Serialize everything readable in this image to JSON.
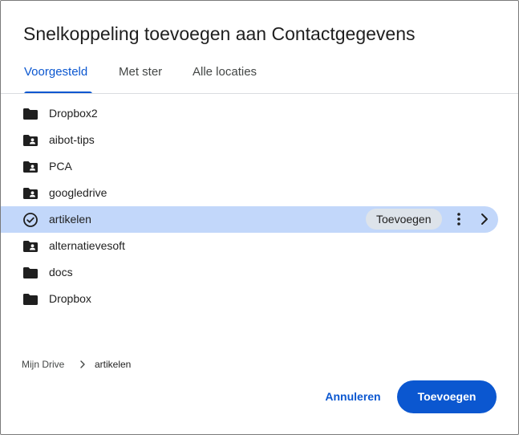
{
  "dialog": {
    "title": "Snelkoppeling toevoegen aan Contactgegevens"
  },
  "tabs": [
    {
      "label": "Voorgesteld",
      "active": true
    },
    {
      "label": "Met ster",
      "active": false
    },
    {
      "label": "Alle locaties",
      "active": false
    }
  ],
  "folders": [
    {
      "label": "Dropbox2",
      "icon": "folder-icon"
    },
    {
      "label": "aibot-tips",
      "icon": "shared-folder-icon"
    },
    {
      "label": "PCA",
      "icon": "shared-folder-icon"
    },
    {
      "label": "googledrive",
      "icon": "shared-folder-icon"
    },
    {
      "label": "artikelen",
      "icon": "check-circle-icon",
      "selected": true,
      "action_label": "Toevoegen"
    },
    {
      "label": "alternatievesoft",
      "icon": "shared-folder-icon"
    },
    {
      "label": "docs",
      "icon": "folder-icon"
    },
    {
      "label": "Dropbox",
      "icon": "folder-icon"
    }
  ],
  "breadcrumb": {
    "root": "Mijn Drive",
    "current": "artikelen"
  },
  "footer": {
    "cancel_label": "Annuleren",
    "confirm_label": "Toevoegen"
  },
  "colors": {
    "accent": "#0b57d0",
    "selected_row": "#c2d7fa",
    "chip": "#dde3ea"
  }
}
